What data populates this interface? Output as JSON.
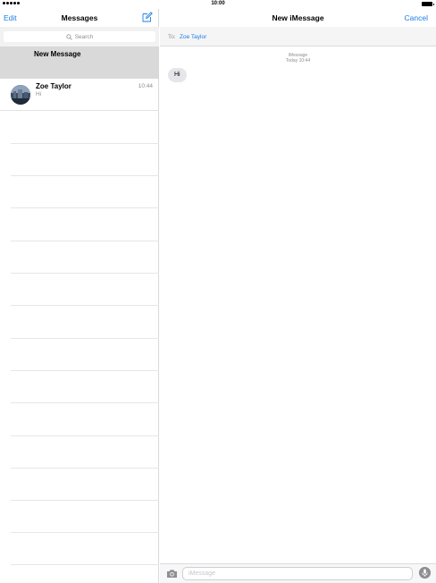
{
  "status_bar": {
    "time": "10:00"
  },
  "left": {
    "edit_label": "Edit",
    "title": "Messages",
    "search_placeholder": "Search",
    "new_message_label": "New Message",
    "conversation": {
      "name": "Zoe Taylor",
      "time": "10:44",
      "preview": "Hi"
    }
  },
  "right": {
    "title": "New iMessage",
    "cancel_label": "Cancel",
    "to_label": "To:",
    "to_recipient": "Zoe Taylor",
    "meta_service": "iMessage",
    "meta_time": "Today 10:44",
    "bubble_text": "Hi",
    "input_placeholder": "iMessage"
  },
  "colors": {
    "accent": "#1a7ee8",
    "secondary_text": "#8e8e93",
    "bubble": "#e6e5ea",
    "selected_row": "#d9d9d9"
  }
}
